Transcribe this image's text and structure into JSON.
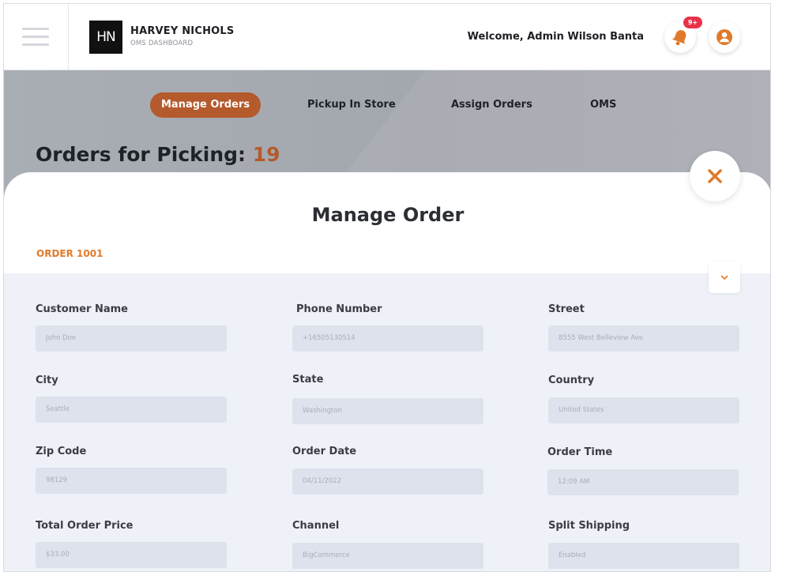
{
  "header": {
    "brand_logo": "HN",
    "brand_name": "HARVEY NICHOLS",
    "brand_sub": "OMS DASHBOARD",
    "welcome": "Welcome, Admin Wilson Banta",
    "notification_badge": "9+",
    "icons": [
      "menu-icon",
      "bell-icon",
      "user-icon"
    ]
  },
  "nav": {
    "tabs": [
      "Manage Orders",
      "Pickup In Store",
      "Assign Orders",
      "OMS"
    ],
    "active": "Manage Orders"
  },
  "summary": {
    "label": "Orders for Picking:",
    "count": "19"
  },
  "modal": {
    "title": "Manage Order",
    "order_id": "ORDER 1001",
    "fields": [
      {
        "label": "Customer Name",
        "value": "John Doe"
      },
      {
        "label": "Phone Number",
        "value": "+16505130514"
      },
      {
        "label": "Street",
        "value": "8555 West Belleview Ave"
      },
      {
        "label": "City",
        "value": "Seattle"
      },
      {
        "label": "State",
        "value": "Washington"
      },
      {
        "label": "Country",
        "value": "United States"
      },
      {
        "label": "Zip Code",
        "value": "98129"
      },
      {
        "label": "Order Date",
        "value": "04/11/2022"
      },
      {
        "label": "Order Time",
        "value": "12:09 AM"
      },
      {
        "label": "Total Order Price",
        "value": "$33.00"
      },
      {
        "label": "Channel",
        "value": "BigCommerce"
      },
      {
        "label": "Split Shipping",
        "value": "Enabled"
      }
    ]
  },
  "colors": {
    "accent_orange": "#e07a2a",
    "active_tab": "#b45a2c",
    "badge_red": "#e8324a",
    "form_background": "#eef1f8",
    "input_background": "#dee2ec"
  }
}
